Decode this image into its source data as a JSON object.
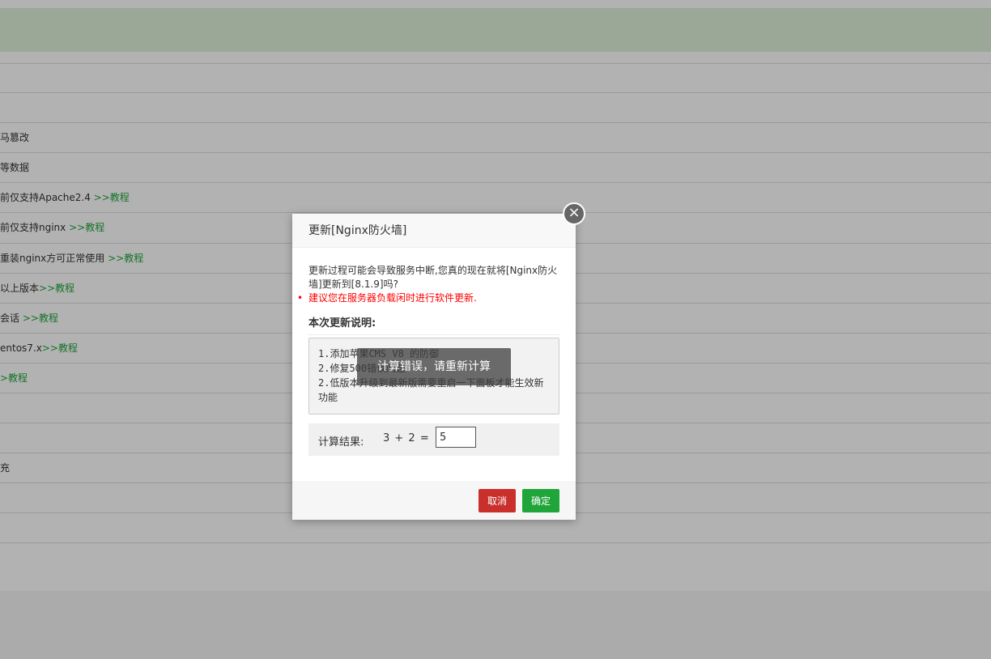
{
  "background": {
    "rows": [
      {
        "text": "",
        "link": ""
      },
      {
        "text": "",
        "link": ""
      },
      {
        "text": "马篡改",
        "link": ""
      },
      {
        "text": "等数据",
        "link": ""
      },
      {
        "text": "前仅支持Apache2.4 ",
        "link": ">>教程"
      },
      {
        "text": "前仅支持nginx ",
        "link": ">>教程"
      },
      {
        "text": "重装nginx方可正常使用 ",
        "link": ">>教程"
      },
      {
        "text": "以上版本",
        "link": ">>教程"
      },
      {
        "text": "会话 ",
        "link": ">>教程"
      },
      {
        "text": "entos7.x",
        "link": ">>教程"
      },
      {
        "text": "",
        "link": ">教程"
      },
      {
        "text": "",
        "link": ""
      },
      {
        "text": "",
        "link": ""
      },
      {
        "text": "充",
        "link": ""
      },
      {
        "text": "",
        "link": ""
      },
      {
        "text": "",
        "link": ""
      },
      {
        "text": "",
        "link": ""
      }
    ]
  },
  "dialog": {
    "title": "更新[Nginx防火墙]",
    "close_icon": "×",
    "message": "更新过程可能会导致服务中断,您真的现在就将[Nginx防火墙]更新到[8.1.9]吗?",
    "warning": "建议您在服务器负载闲时进行软件更新.",
    "warning_bullet": "•",
    "section_title": "本次更新说明:",
    "notes": [
      "1.添加苹果CMS V8 的防御",
      "2.修复500错误问题",
      "2.低版本升级到最新版需要重启一下面板才能生效新功能"
    ],
    "toast": "计算错误，请重新计算",
    "calc": {
      "label": "计算结果:",
      "expression": "3 + 2  =",
      "value": "5"
    },
    "buttons": {
      "cancel": "取消",
      "confirm": "确定"
    }
  }
}
